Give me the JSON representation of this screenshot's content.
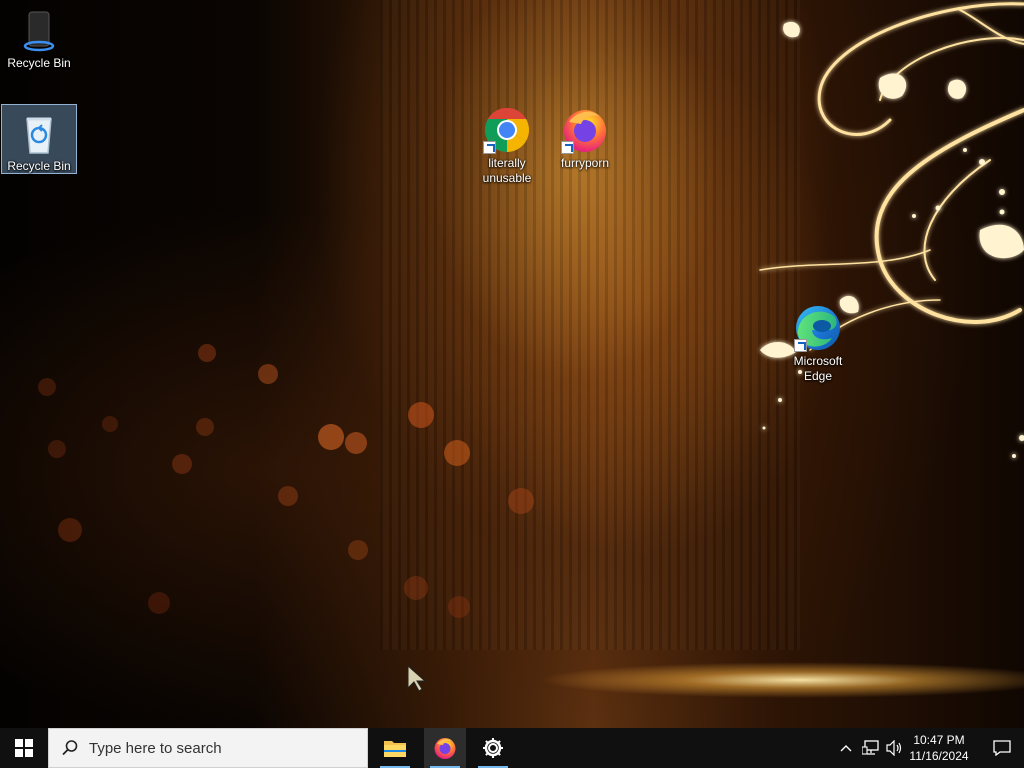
{
  "desktop": {
    "icons": [
      {
        "label": "Recycle Bin",
        "icon": "speaker-icon"
      },
      {
        "label": "Recycle Bin",
        "icon": "recycle-bin-icon"
      },
      {
        "label": "literally unusable",
        "icon": "chrome-icon"
      },
      {
        "label": "furryporn",
        "icon": "firefox-icon"
      },
      {
        "label": "Microsoft Edge",
        "icon": "edge-icon"
      }
    ]
  },
  "taskbar": {
    "start_icon": "windows-logo-icon",
    "search_placeholder": "Type here to search",
    "apps": [
      {
        "icon": "file-explorer-icon",
        "running": true
      },
      {
        "icon": "firefox-icon",
        "running": true,
        "active": true
      },
      {
        "icon": "settings-gear-icon",
        "running": true
      }
    ],
    "tray": {
      "icons": [
        "chevron-up-icon",
        "network-icon",
        "volume-icon"
      ],
      "time": "10:47 PM",
      "date": "11/16/2024",
      "notification_icon": "notification-icon"
    }
  },
  "colors": {
    "taskbar": "#101010",
    "search_box": "#f3f3f3",
    "running_indicator": "#76b9ed",
    "wallpaper_glow": "#f0a83c"
  }
}
